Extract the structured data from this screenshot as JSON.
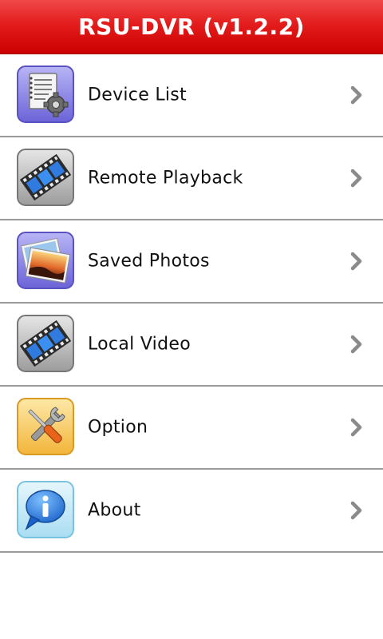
{
  "header": {
    "title": "RSU-DVR (v1.2.2)"
  },
  "menu": {
    "items": [
      {
        "label": "Device List",
        "icon": "device-list-icon"
      },
      {
        "label": "Remote Playback",
        "icon": "film-icon"
      },
      {
        "label": "Saved Photos",
        "icon": "photos-icon"
      },
      {
        "label": "Local Video",
        "icon": "film-icon"
      },
      {
        "label": "Option",
        "icon": "tools-icon"
      },
      {
        "label": "About",
        "icon": "info-icon"
      }
    ]
  },
  "colors": {
    "header": "#e31c1c",
    "divider": "#9a9a9a",
    "chevron": "#8a8a8a"
  }
}
